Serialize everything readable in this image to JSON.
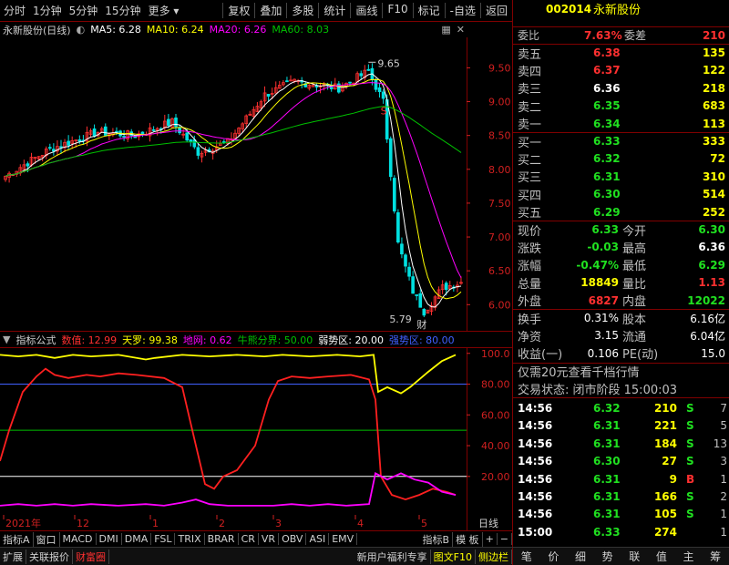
{
  "toolbar": {
    "left": [
      "分时",
      "1分钟",
      "5分钟",
      "15分钟",
      "更多"
    ],
    "right": [
      "复权",
      "叠加",
      "多股",
      "统计",
      "画线",
      "F10",
      "标记",
      "-自选",
      "返回"
    ]
  },
  "kline": {
    "stock_name": "永新股份(日线)",
    "ma5": "MA5: 6.28",
    "ma10": "MA10: 6.24",
    "ma20": "MA20: 6.26",
    "ma60": "MA60: 8.03",
    "high_label": "9.65",
    "low_label": "5.79",
    "s_mark": "S",
    "cai_mark": "财",
    "y_ticks": [
      "9.50",
      "9.00",
      "8.50",
      "8.00",
      "7.50",
      "7.00",
      "6.50",
      "6.00"
    ]
  },
  "indicator": {
    "title": "指标公式",
    "shuzhi": "数值: 12.99",
    "tianluo": "天罗: 99.38",
    "diwang": "地网: 0.62",
    "niuxiong": "牛熊分界: 50.00",
    "ruoshi": "弱势区: 20.00",
    "qiangshi": "强势区: 80.00",
    "y_ticks": [
      "100.0",
      "80.00",
      "60.00",
      "40.00",
      "20.00"
    ]
  },
  "xaxis": {
    "labels": [
      "2021年",
      "12",
      "1",
      "2",
      "3",
      "4",
      "5"
    ],
    "right_label": "日线"
  },
  "tabs": [
    "指标A",
    "窗口",
    "MACD",
    "DMI",
    "DMA",
    "FSL",
    "TRIX",
    "BRAR",
    "CR",
    "VR",
    "OBV",
    "ASI",
    "EMV",
    "指标B",
    "模 板",
    "+",
    "−"
  ],
  "statusbar": {
    "left": [
      "扩展",
      "关联报价",
      "财富圈"
    ],
    "promo": "新用户福利专享",
    "right": [
      "图文F10",
      "侧边栏"
    ],
    "panel_tabs": [
      "笔",
      "价",
      "细",
      "势",
      "联",
      "值",
      "主",
      "筹"
    ]
  },
  "panel": {
    "code": "002014",
    "name": "永新股份",
    "weibi_label": "委比",
    "weibi": "7.63%",
    "weicha_label": "委差",
    "weicha": "210",
    "sell": [
      {
        "label": "卖五",
        "price": "6.38",
        "vol": "135"
      },
      {
        "label": "卖四",
        "price": "6.37",
        "vol": "122"
      },
      {
        "label": "卖三",
        "price": "6.36",
        "vol": "218"
      },
      {
        "label": "卖二",
        "price": "6.35",
        "vol": "683"
      },
      {
        "label": "卖一",
        "price": "6.34",
        "vol": "113"
      }
    ],
    "buy": [
      {
        "label": "买一",
        "price": "6.33",
        "vol": "333"
      },
      {
        "label": "买二",
        "price": "6.32",
        "vol": "72"
      },
      {
        "label": "买三",
        "price": "6.31",
        "vol": "310"
      },
      {
        "label": "买四",
        "price": "6.30",
        "vol": "514"
      },
      {
        "label": "买五",
        "price": "6.29",
        "vol": "252"
      }
    ],
    "quote": [
      [
        "现价",
        "6.33",
        "今开",
        "6.30"
      ],
      [
        "涨跌",
        "-0.03",
        "最高",
        "6.36"
      ],
      [
        "涨幅",
        "-0.47%",
        "最低",
        "6.29"
      ],
      [
        "总量",
        "18849",
        "量比",
        "1.13"
      ],
      [
        "外盘",
        "6827",
        "内盘",
        "12022"
      ]
    ],
    "stats": [
      [
        "换手",
        "0.31%",
        "股本",
        "6.16亿"
      ],
      [
        "净资",
        "3.15",
        "流通",
        "6.04亿"
      ],
      [
        "收益(一)",
        "0.106",
        "PE(动)",
        "15.0"
      ]
    ],
    "promo": "仅需20元查看千档行情",
    "state": "交易状态: 闭市阶段 15:00:03",
    "ticks": [
      {
        "t": "14:56",
        "p": "6.32",
        "v": "210",
        "s": "S",
        "n": "7"
      },
      {
        "t": "14:56",
        "p": "6.31",
        "v": "221",
        "s": "S",
        "n": "5"
      },
      {
        "t": "14:56",
        "p": "6.31",
        "v": "184",
        "s": "S",
        "n": "13"
      },
      {
        "t": "14:56",
        "p": "6.30",
        "v": "27",
        "s": "S",
        "n": "3"
      },
      {
        "t": "14:56",
        "p": "6.31",
        "v": "9",
        "s": "B",
        "n": "1"
      },
      {
        "t": "14:56",
        "p": "6.31",
        "v": "166",
        "s": "S",
        "n": "2"
      },
      {
        "t": "14:56",
        "p": "6.31",
        "v": "105",
        "s": "S",
        "n": "1"
      },
      {
        "t": "15:00",
        "p": "6.33",
        "v": "274",
        "s": "",
        "n": "1"
      }
    ]
  },
  "colors": {
    "up": "#ff3030",
    "down": "#20e020",
    "ma5": "#ffffff",
    "ma10": "#ffff00",
    "ma20": "#ff00ff",
    "ma60": "#00c000",
    "accent": "#800000"
  }
}
